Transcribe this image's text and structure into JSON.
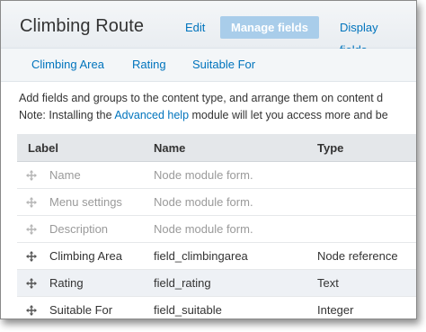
{
  "header": {
    "title": "Climbing Route",
    "tabs": [
      {
        "label": "Edit",
        "active": false
      },
      {
        "label": "Manage fields",
        "active": true
      },
      {
        "label": "Display fields",
        "active": false
      }
    ]
  },
  "subtabs": [
    "Climbing Area",
    "Rating",
    "Suitable For"
  ],
  "description": {
    "line1": "Add fields and groups to the content type, and arrange them on content d",
    "line2_prefix": "Note: Installing the ",
    "line2_link": "Advanced help",
    "line2_suffix": " module will let you access more and be"
  },
  "table": {
    "headers": {
      "label": "Label",
      "name": "Name",
      "type": "Type"
    },
    "rows": [
      {
        "label": "Name",
        "name": "Node module form.",
        "type": "",
        "muted": true
      },
      {
        "label": "Menu settings",
        "name": "Node module form.",
        "type": "",
        "muted": true
      },
      {
        "label": "Description",
        "name": "Node module form.",
        "type": "",
        "muted": true
      },
      {
        "label": "Climbing Area",
        "name": "field_climbingarea",
        "type": "Node reference",
        "muted": false
      },
      {
        "label": "Rating",
        "name": "field_rating",
        "type": "Text",
        "muted": false
      },
      {
        "label": "Suitable For",
        "name": "field_suitable",
        "type": "Integer",
        "muted": false
      }
    ]
  },
  "icons": {
    "drag_handle": "drag-handle-icon"
  },
  "colors": {
    "link": "#0074bd",
    "active_tab_bg": "#a9cdea",
    "header_bg": "#e4e7ea",
    "muted_text": "#9a9a9a"
  }
}
